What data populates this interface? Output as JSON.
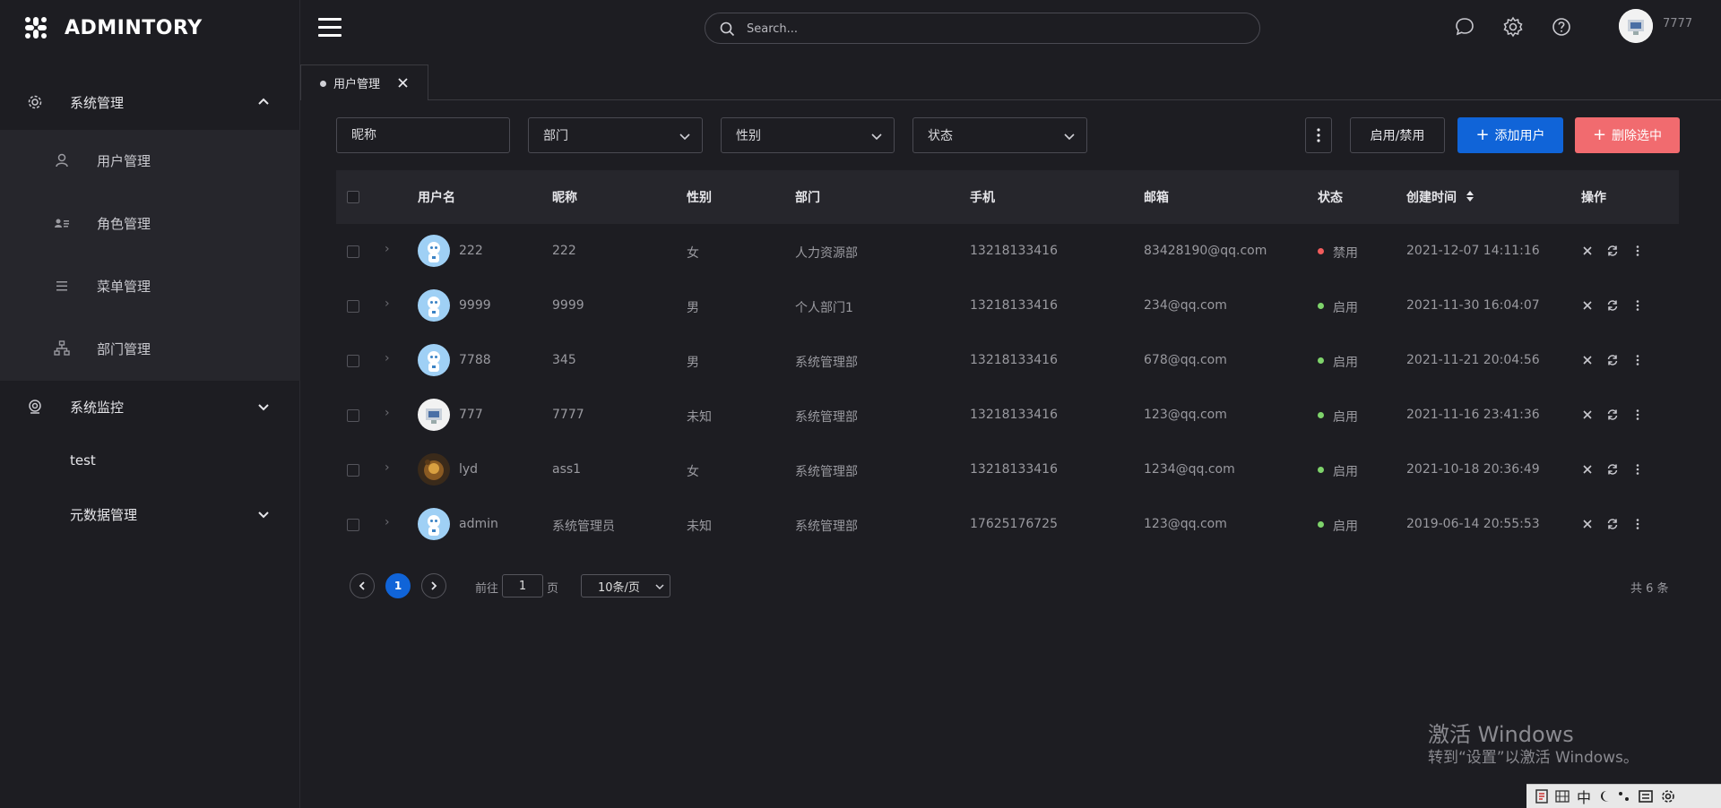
{
  "app": {
    "brand": "ADMINTORY"
  },
  "sidebar": {
    "groups": [
      {
        "label": "系统管理",
        "icon": "gear-icon",
        "expanded": true
      },
      {
        "label": "系统监控",
        "icon": "monitor-icon",
        "expanded": false
      },
      {
        "label": "元数据管理",
        "icon": "",
        "expanded": false
      }
    ],
    "items": [
      {
        "label": "用户管理",
        "icon": "user-icon"
      },
      {
        "label": "角色管理",
        "icon": "id-card-icon"
      },
      {
        "label": "菜单管理",
        "icon": "menu-lines-icon"
      },
      {
        "label": "部门管理",
        "icon": "org-tree-icon"
      }
    ],
    "test_label": "test"
  },
  "topbar": {
    "search_placeholder": "Search...",
    "icons": [
      "chat-icon",
      "gear-icon",
      "help-icon"
    ],
    "username": "7777"
  },
  "tabs": [
    {
      "label": "用户管理",
      "closable": true
    }
  ],
  "filters": {
    "nickname_placeholder": "昵称",
    "department": "部门",
    "gender": "性别",
    "status": "状态"
  },
  "toolbar": {
    "toggle_label": "启用/禁用",
    "add_label": "添加用户",
    "delete_label": "删除选中",
    "add_color": "#1064d8",
    "delete_color": "#f16b6f"
  },
  "table": {
    "headers": {
      "username": "用户名",
      "nickname": "昵称",
      "gender": "性别",
      "department": "部门",
      "phone": "手机",
      "email": "邮箱",
      "status": "状态",
      "created": "创建时间",
      "actions": "操作"
    },
    "rows": [
      {
        "username": "222",
        "nickname": "222",
        "gender": "女",
        "department": "人力资源部",
        "phone": "13218133416",
        "email": "83428190@qq.com",
        "status": "禁用",
        "status_color": "#f25c5c",
        "created": "2021-12-07 14:11:16",
        "avatar": "robot"
      },
      {
        "username": "9999",
        "nickname": "9999",
        "gender": "男",
        "department": "个人部门1",
        "phone": "13218133416",
        "email": "234@qq.com",
        "status": "启用",
        "status_color": "#7ed36b",
        "created": "2021-11-30 16:04:07",
        "avatar": "robot"
      },
      {
        "username": "7788",
        "nickname": "345",
        "gender": "男",
        "department": "系统管理部",
        "phone": "13218133416",
        "email": "678@qq.com",
        "status": "启用",
        "status_color": "#7ed36b",
        "created": "2021-11-21 20:04:56",
        "avatar": "robot"
      },
      {
        "username": "777",
        "nickname": "7777",
        "gender": "未知",
        "department": "系统管理部",
        "phone": "13218133416",
        "email": "123@qq.com",
        "status": "启用",
        "status_color": "#7ed36b",
        "created": "2021-11-16 23:41:36",
        "avatar": "screen"
      },
      {
        "username": "lyd",
        "nickname": "ass1",
        "gender": "女",
        "department": "系统管理部",
        "phone": "13218133416",
        "email": "1234@qq.com",
        "status": "启用",
        "status_color": "#7ed36b",
        "created": "2021-10-18 20:36:49",
        "avatar": "photo"
      },
      {
        "username": "admin",
        "nickname": "系统管理员",
        "gender": "未知",
        "department": "系统管理部",
        "phone": "17625176725",
        "email": "123@qq.com",
        "status": "启用",
        "status_color": "#7ed36b",
        "created": "2019-06-14 20:55:53",
        "avatar": "robot"
      }
    ]
  },
  "pagination": {
    "current_page": "1",
    "goto_prefix": "前往",
    "goto_value": "1",
    "goto_suffix": "页",
    "page_size": "10条/页",
    "total": "共 6 条"
  },
  "system": {
    "watermark_title": "激活 Windows",
    "watermark_sub": "转到“设置”以激活 Windows。",
    "ime_label": "中"
  }
}
